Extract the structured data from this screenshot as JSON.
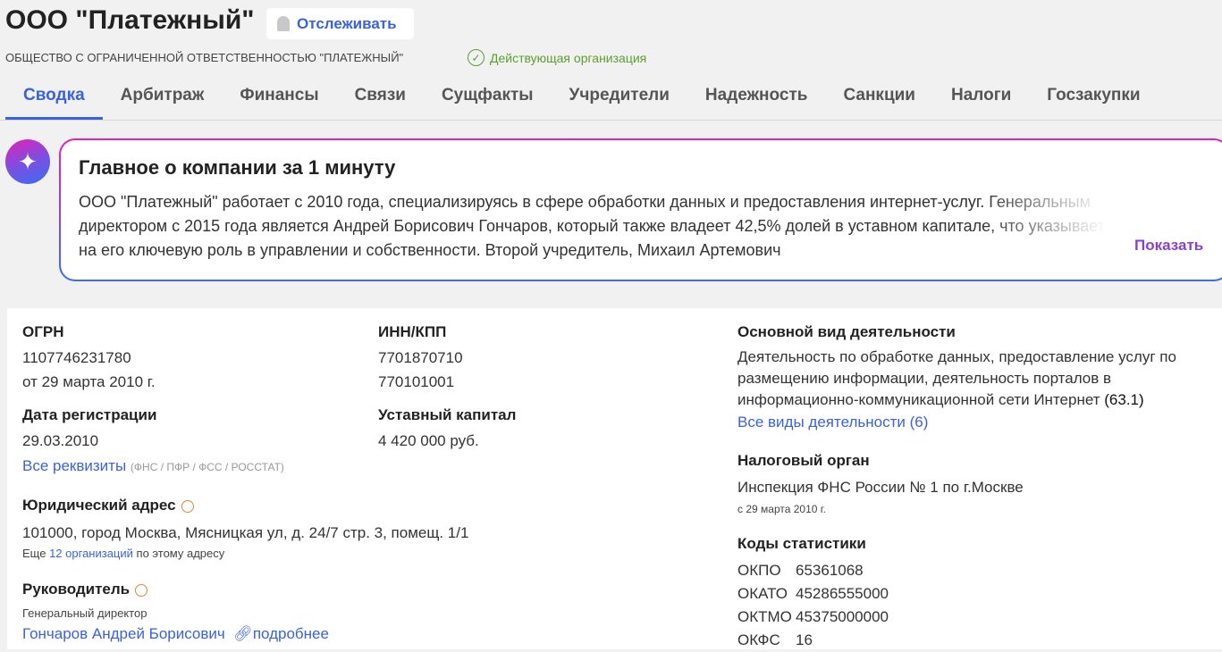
{
  "header": {
    "title": "ООО \"Платежный\"",
    "follow_label": "Отслеживать",
    "full_name": "ОБЩЕСТВО С ОГРАНИЧЕННОЙ ОТВЕТСТВЕННОСТЬЮ \"ПЛАТЕЖНЫЙ\"",
    "status": "Действующая организация"
  },
  "tabs": [
    "Сводка",
    "Арбитраж",
    "Финансы",
    "Связи",
    "Сущфакты",
    "Учредители",
    "Надежность",
    "Санкции",
    "Налоги",
    "Госзакупки"
  ],
  "ai": {
    "title": "Главное о компании за 1 минуту",
    "text": "ООО \"Платежный\" работает с 2010 года, специализируясь в сфере обработки данных и предоставления интернет-услуг. Генеральным директором с 2015 года является Андрей Борисович Гончаров, который также владеет 42,5% долей в уставном капитале, что указывает на его ключевую роль в управлении и собственности. Второй учредитель, Михаил Артемович",
    "show_label": "Показать"
  },
  "details": {
    "ogrn_label": "ОГРН",
    "ogrn": "1107746231780",
    "ogrn_date": "от 29 марта 2010 г.",
    "reg_label": "Дата регистрации",
    "reg_date": "29.03.2010",
    "all_req": "Все реквизиты",
    "all_req_note": "(ФНС / ПФР / ФСС / РОССТАТ)",
    "inn_label": "ИНН/КПП",
    "inn": "7701870710",
    "kpp": "770101001",
    "capital_label": "Уставный капитал",
    "capital": "4 420 000 руб.",
    "address_label": "Юридический адрес",
    "address": "101000, город Москва, Мясницкая ул, д. 24/7 стр. 3, помещ. 1/1",
    "address_more_pre": "Еще",
    "address_more_link": "12 организаций",
    "address_more_post": "по этому адресу",
    "head_label": "Руководитель",
    "head_role": "Генеральный директор",
    "head_name": "Гончаров Андрей Борисович",
    "head_more": "подробнее",
    "activity_label": "Основной вид деятельности",
    "activity": "Деятельность по обработке данных, предоставление услуг по размещению информации, деятельность порталов в информационно-коммуникационной сети Интернет",
    "activity_code": "(63.1)",
    "activity_all": "Все виды деятельности (6)",
    "tax_label": "Налоговый орган",
    "tax": "Инспекция ФНС России № 1 по г.Москве",
    "tax_date": "с 29 марта 2010 г.",
    "stats_label": "Коды статистики",
    "stats": [
      {
        "k": "ОКПО",
        "v": "65361068"
      },
      {
        "k": "ОКАТО",
        "v": "45286555000"
      },
      {
        "k": "ОКТМО",
        "v": "45375000000"
      },
      {
        "k": "ОКФС",
        "v": "16"
      }
    ]
  }
}
